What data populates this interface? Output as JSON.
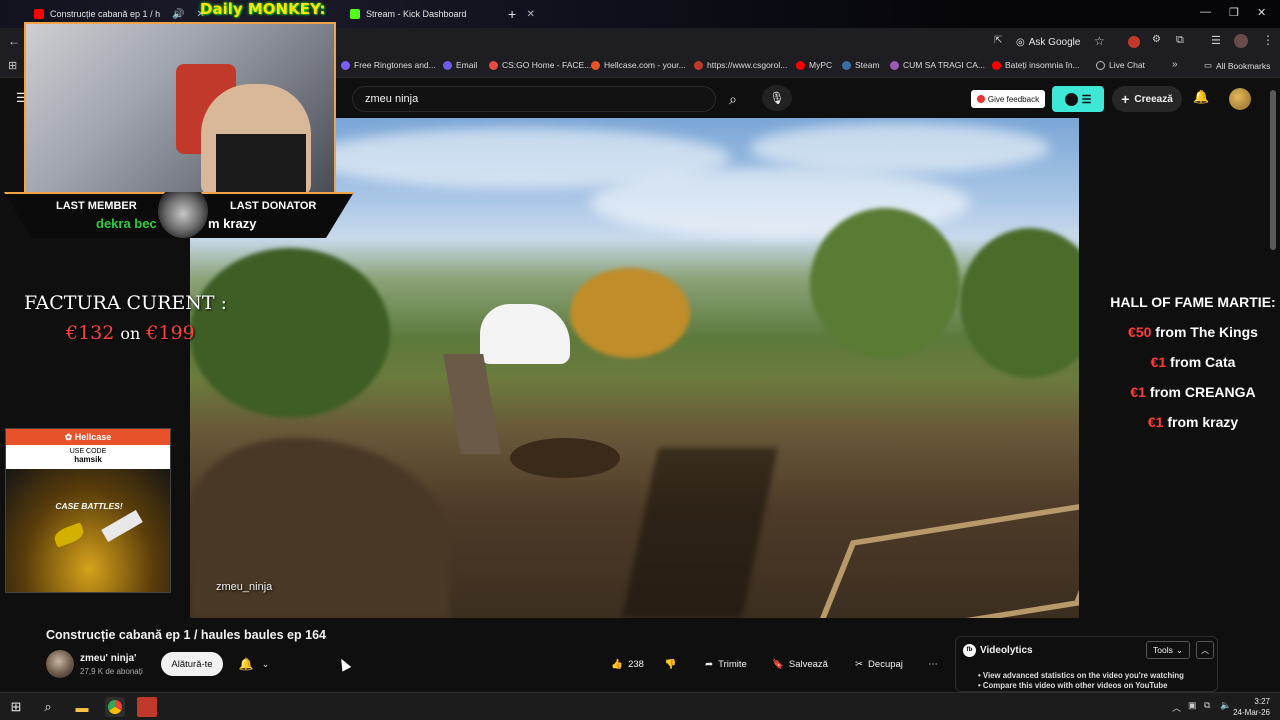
{
  "browser": {
    "tabs": [
      {
        "title": "Construcție cabană ep 1 / h"
      },
      {
        "title": "Stream - Kick Dashboard"
      }
    ],
    "overlay_banner": "Daily MONKEY:",
    "ask_google": "Ask Google",
    "bookmarks": [
      "Free Ringtones and...",
      "Email",
      "CS:GO Home - FACE...",
      "Hellcase.com - your...",
      "https://www.csgorol...",
      "MyPC",
      "Steam",
      "CUM SA TRAGI CA...",
      "Bateți insomnia în...",
      "Live Chat"
    ],
    "all_bookmarks": "All Bookmarks"
  },
  "youtube": {
    "search_value": "zmeu ninja",
    "give_feedback": "Give feedback",
    "create_label": "Creează"
  },
  "overlay": {
    "last_member_label": "LAST MEMBER",
    "last_member_name": "dekra bec",
    "last_donator_label": "LAST DONATOR",
    "last_donator_name": "m krazy",
    "factura_title": "FACTURA CURENT :",
    "factura_current": "€132",
    "factura_on": "on",
    "factura_goal": "€199",
    "hof_title": "HALL OF FAME MARTIE:",
    "hof_entries": [
      {
        "amount": "€50",
        "text": "from The Kings"
      },
      {
        "amount": "€1",
        "text": "from Cata"
      },
      {
        "amount": "€1",
        "text": "from CREANGA"
      },
      {
        "amount": "€1",
        "text": "from krazy"
      }
    ],
    "hellcase_brand": "Hellcase",
    "hellcase_use_code": "USE CODE",
    "hellcase_code": "hamsik",
    "hellcase_promo": "CASE BATTLES!",
    "video_watermark": "zmeu_ninja"
  },
  "video": {
    "title": "Construcție cabană ep 1 / haules baules ep 164",
    "channel": "zmeu' ninja'",
    "subscribers": "27,9 K de abonați",
    "join": "Alătură-te",
    "likes": "238",
    "share": "Trimite",
    "save": "Salvează",
    "clip": "Decupaj"
  },
  "videolytics": {
    "title": "Videolytics",
    "tools": "Tools",
    "bullets": [
      "View advanced statistics on the video you're watching",
      "Compare this video with other videos on YouTube"
    ]
  },
  "taskbar": {
    "time": "3:27",
    "date": "24-Mar-26"
  },
  "colors": {
    "accent_orange": "#f2a34a",
    "donation_red": "#ff3b3b",
    "yt_teal": "#3ee8d6"
  }
}
